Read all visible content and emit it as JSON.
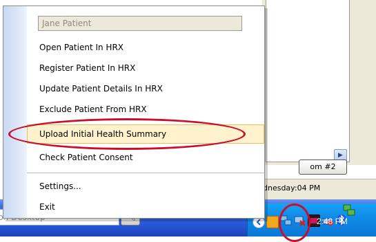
{
  "patient_header": "Jane Patient",
  "menu_items": [
    "Open Patient In HRX",
    "Register Patient In HRX",
    "Update Patient Details In HRX",
    "Exclude Patient From HRX",
    "Upload Initial Health Summary",
    "Check Patient Consent",
    "Settings...",
    "Exit"
  ],
  "highlighted_item": "Upload Initial Health Summary",
  "background": {
    "room_button": "om #2",
    "status_text": "dnesday:04 PM",
    "scroll_arrow": "▶"
  },
  "taskbar": {
    "search_text": "ion Desktop",
    "clock": "2:48 PM"
  },
  "tray_icons": [
    "chevron-left-icon",
    "folder-icon",
    "network-icon",
    "network-error-icon",
    "app-icon",
    "printer-icon",
    "bluetooth-icon",
    "network-connection-icon"
  ],
  "colors": {
    "annotation_red": "#c8102e",
    "menu_highlight": "#fff2cc",
    "taskbar_blue": "#2756d6"
  }
}
